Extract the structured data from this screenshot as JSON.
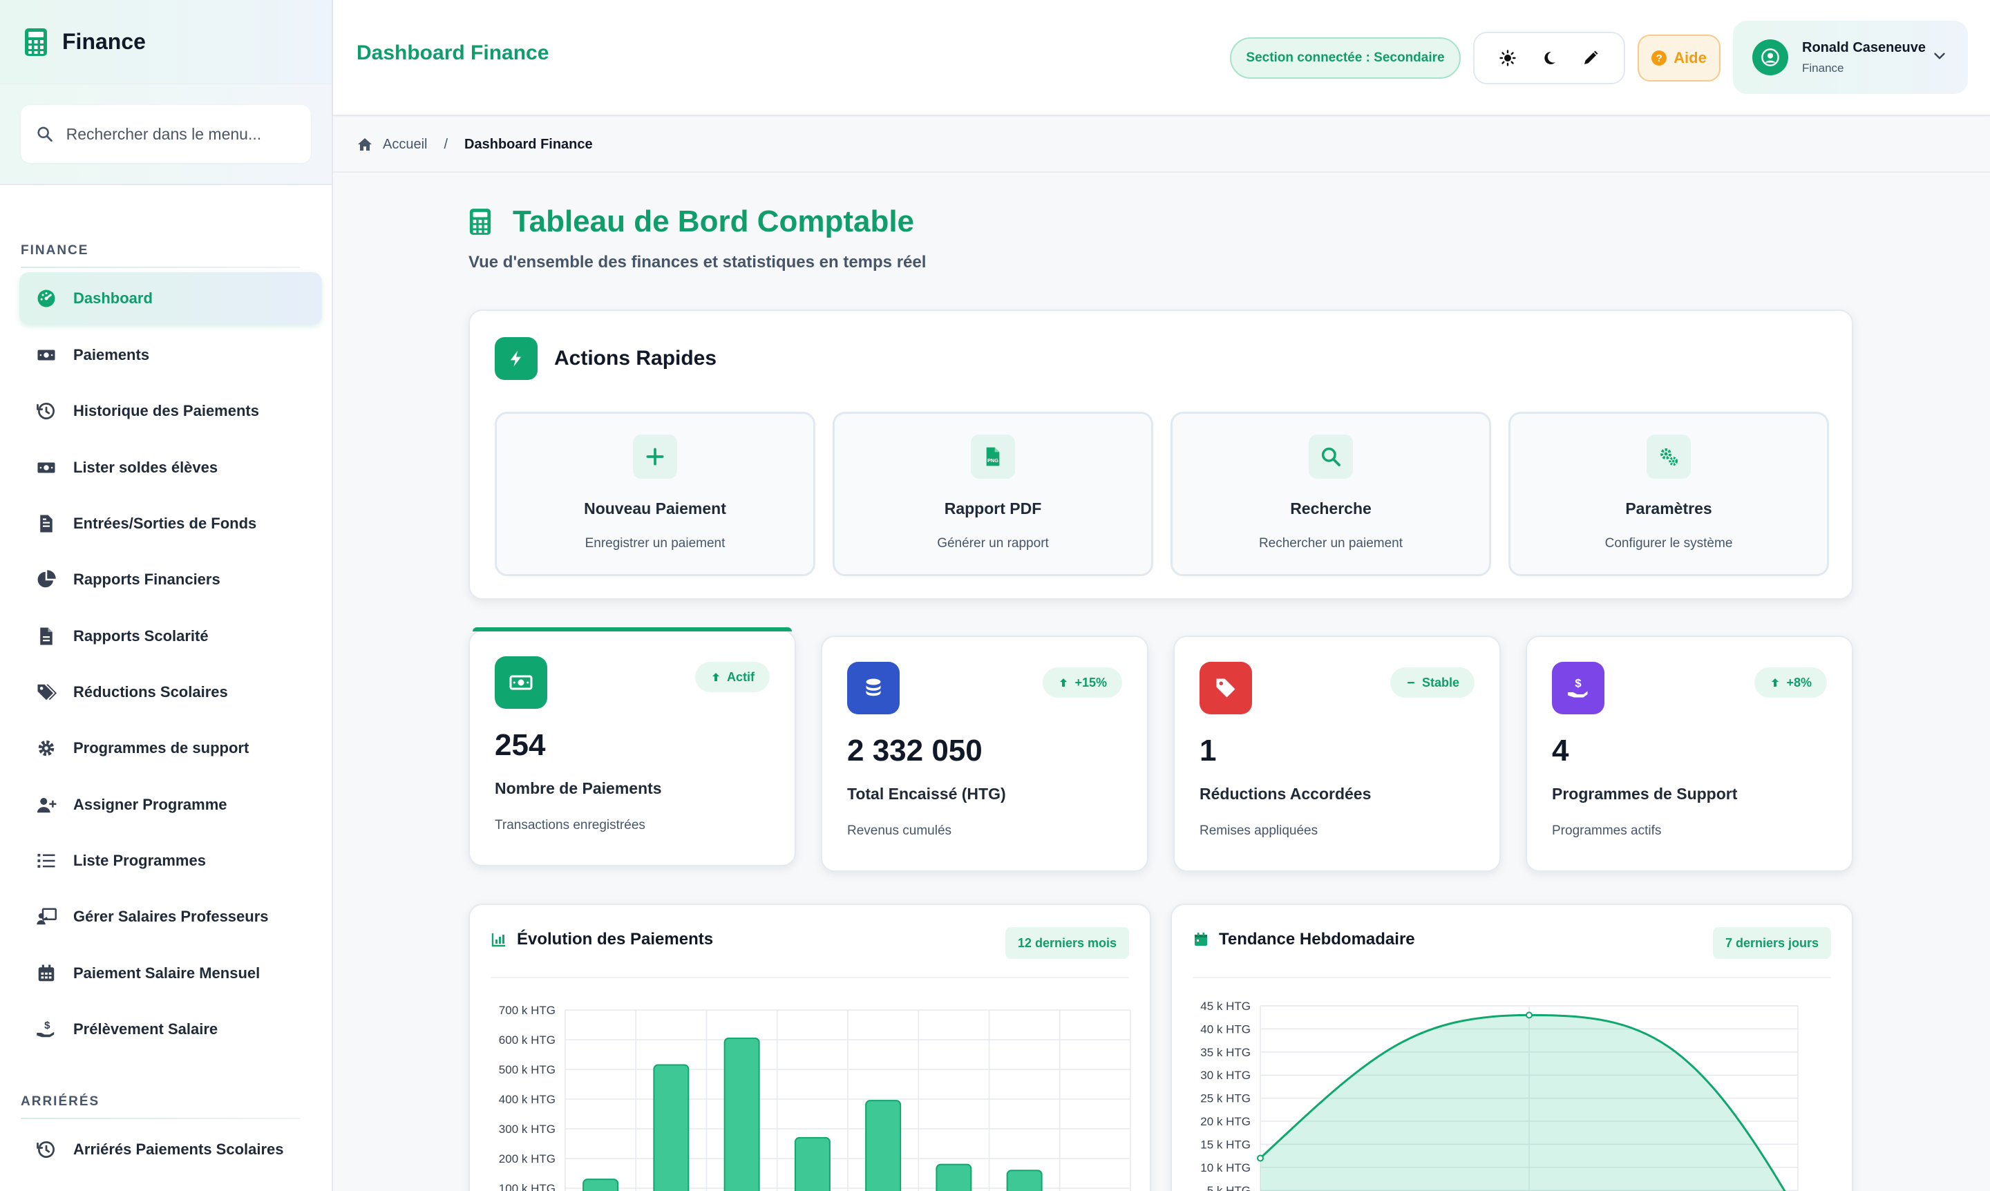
{
  "sidebar": {
    "brand": "Finance",
    "search_placeholder": "Rechercher dans le menu...",
    "section_finance": "FINANCE",
    "section_arrieres": "ARRIÉRÉS",
    "items": [
      {
        "label": "Dashboard",
        "icon": "gauge-icon"
      },
      {
        "label": "Paiements",
        "icon": "money-bill-icon"
      },
      {
        "label": "Historique des Paiements",
        "icon": "history-icon"
      },
      {
        "label": "Lister soldes élèves",
        "icon": "money-bill-icon"
      },
      {
        "label": "Entrées/Sorties de Fonds",
        "icon": "file-invoice-icon"
      },
      {
        "label": "Rapports Financiers",
        "icon": "pie-chart-icon"
      },
      {
        "label": "Rapports Scolarité",
        "icon": "file-icon"
      },
      {
        "label": "Réductions Scolaires",
        "icon": "tags-icon"
      },
      {
        "label": "Programmes de support",
        "icon": "gear-icon"
      },
      {
        "label": "Assigner Programme",
        "icon": "user-plus-icon"
      },
      {
        "label": "Liste Programmes",
        "icon": "list-icon"
      },
      {
        "label": "Gérer Salaires Professeurs",
        "icon": "teacher-icon"
      },
      {
        "label": "Paiement Salaire Mensuel",
        "icon": "calendar-icon"
      },
      {
        "label": "Prélèvement Salaire",
        "icon": "hand-dollar-icon"
      }
    ],
    "arrieres_items": [
      {
        "label": "Arriérés Paiements Scolaires",
        "icon": "history-icon"
      }
    ]
  },
  "header": {
    "title": "Dashboard Finance",
    "section": "Section connectée : Secondaire",
    "help": "Aide",
    "user_name": "Ronald Caseneuve",
    "user_role": "Finance"
  },
  "breadcrumb": {
    "home": "Accueil",
    "separator": "/",
    "current": "Dashboard Finance"
  },
  "page": {
    "title": "Tableau de Bord Comptable",
    "subtitle": "Vue d'ensemble des finances et statistiques en temps réel"
  },
  "quick_actions": {
    "title": "Actions Rapides",
    "tiles": [
      {
        "title": "Nouveau Paiement",
        "desc": "Enregistrer un paiement",
        "icon": "plus-icon"
      },
      {
        "title": "Rapport PDF",
        "desc": "Générer un rapport",
        "icon": "file-png-icon"
      },
      {
        "title": "Recherche",
        "desc": "Rechercher un paiement",
        "icon": "search-icon"
      },
      {
        "title": "Paramètres",
        "desc": "Configurer le système",
        "icon": "gears-icon"
      }
    ]
  },
  "stats": [
    {
      "value": "254",
      "label": "Nombre de Paiements",
      "desc": "Transactions enregistrées",
      "badge": "Actif",
      "color": "#10a66f"
    },
    {
      "value": "2 332 050",
      "label": "Total Encaissé (HTG)",
      "desc": "Revenus cumulés",
      "badge": "+15%",
      "color": "#2f55c8"
    },
    {
      "value": "1",
      "label": "Réductions Accordées",
      "desc": "Remises appliquées",
      "badge": "Stable",
      "color": "#e23b3b"
    },
    {
      "value": "4",
      "label": "Programmes de Support",
      "desc": "Programmes actifs",
      "badge": "+8%",
      "color": "#7c45e8"
    }
  ],
  "colors": {
    "accent": "#10a66f",
    "accent_text": "#0f9d6b",
    "help": "#f39c12"
  },
  "chart_data": [
    {
      "type": "bar",
      "title": "Évolution des Paiements",
      "badge": "12 derniers mois",
      "y_ticks": [
        "100 k HTG",
        "200 k HTG",
        "300 k HTG",
        "400 k HTG",
        "500 k HTG",
        "600 k HTG",
        "700 k HTG"
      ],
      "ylim": [
        0,
        700000
      ],
      "values": [
        130000,
        515000,
        605000,
        270000,
        395000,
        180000,
        160000,
        0
      ],
      "grid": true
    },
    {
      "type": "area",
      "title": "Tendance Hebdomadaire",
      "badge": "7 derniers jours",
      "y_ticks": [
        "5 k HTG",
        "10 k HTG",
        "15 k HTG",
        "20 k HTG",
        "25 k HTG",
        "30 k HTG",
        "35 k HTG",
        "40 k HTG",
        "45 k HTG"
      ],
      "ylim": [
        0,
        45000
      ],
      "values": [
        12000,
        43000,
        0
      ],
      "grid": true
    }
  ]
}
